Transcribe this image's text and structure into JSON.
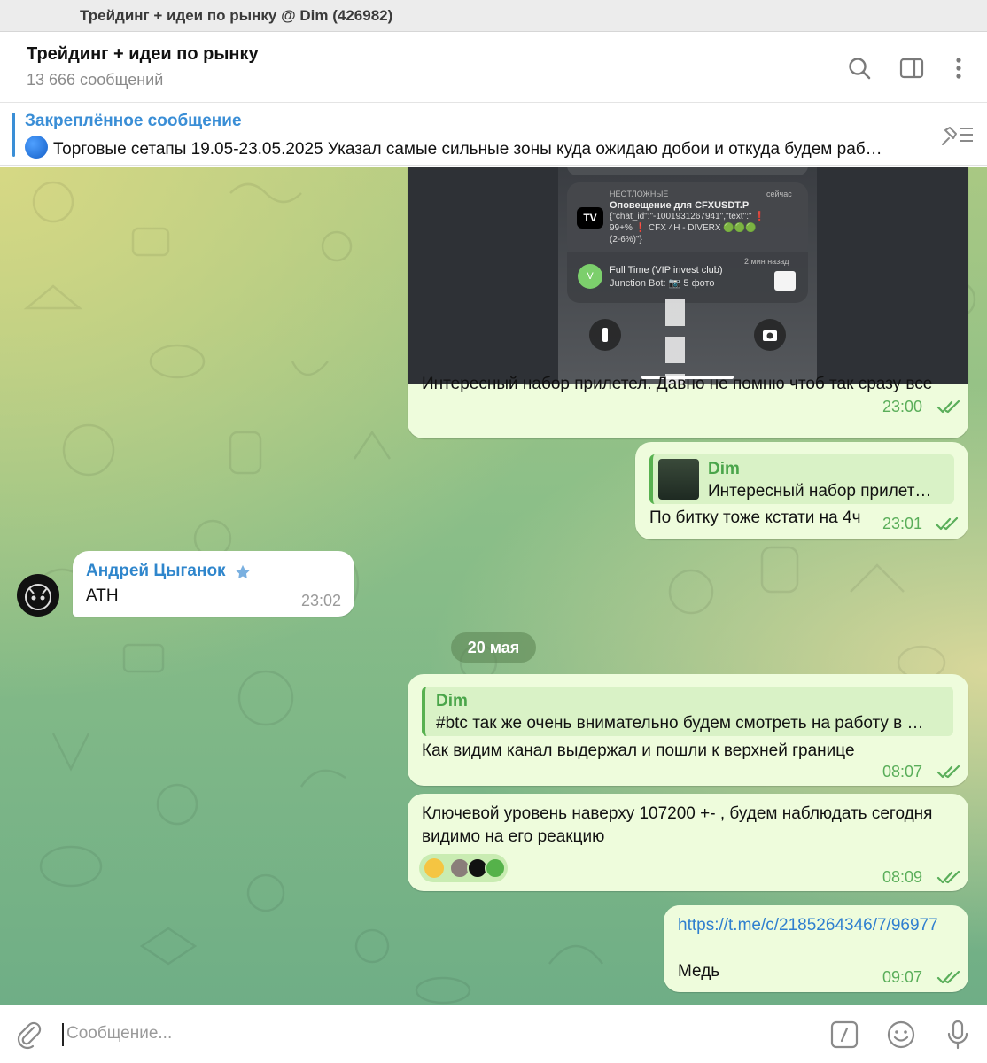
{
  "window": {
    "title": "Трейдинг + идеи по рынку @ Dim (426982)"
  },
  "header": {
    "chat_name": "Трейдинг + идеи по рынку",
    "message_count": "13 666 сообщений"
  },
  "pinned": {
    "title": "Закреплённое сообщение",
    "text": "Торговые сетапы 19.05-23.05.2025  Указал самые сильные зоны куда ожидаю добои и откуда будем раб…"
  },
  "photo": {
    "notif1_tag": "НЕОТЛОЖНЫЕ",
    "notif1_time": "сейчас",
    "notif1_title": "Оповещение для CFXUSDT.P",
    "notif1_line1": "{\"chat_id\":\"-1001931267941\",\"text\":\" ❗",
    "notif1_line2": "99+% ❗ CFX 4H - DIVERX 🟢🟢🟢",
    "notif1_line3": "(2-6%)\"}",
    "notif1_logo": "TV",
    "notif2_title": "Full Time (VIP invest club)",
    "notif2_text": "Junction Bot: 📷 5 фото",
    "notif2_time": "2 мин назад",
    "notif2_avatar": "V"
  },
  "messages": [
    {
      "text": "Интересный набор прилетел. Давно не помню чтоб так сразу все",
      "time": "23:00"
    },
    {
      "reply_name": "Dim",
      "reply_text": "Интересный набор прилет…",
      "text": "По битку тоже кстати на 4ч",
      "time": "23:01"
    },
    {
      "sender": "Андрей Цыганок",
      "text": "ATH",
      "time": "23:02"
    },
    {
      "reply_name": "Dim",
      "reply_text": "#btc так же очень внимательно будем смотреть на работу в …",
      "text": "Как видим канал выдержал и пошли к верхней границе",
      "time": "08:07"
    },
    {
      "text_line1": "Ключевой уровень наверху 107200 +- , будем наблюдать сегодня",
      "text_line2": "видимо на его реакцию",
      "time": "08:09"
    },
    {
      "link": "https://t.me/c/2185264346/7/96977",
      "text": "Медь",
      "time": "09:07"
    }
  ],
  "date_separator": "20 мая",
  "composer": {
    "placeholder": "Сообщение..."
  },
  "icons": {
    "search": "search-icon",
    "sidebar": "sidebar-toggle-icon",
    "more": "more-vertical-icon",
    "unpin": "pin-list-icon",
    "attach": "paperclip-icon",
    "commands": "slash-commands-icon",
    "emoji": "emoji-icon",
    "mic": "microphone-icon",
    "star": "star-icon",
    "read": "double-check-icon"
  },
  "colors": {
    "accent": "#3a8ed6",
    "outgoing_bubble": "#eefcdc",
    "outgoing_meta": "#5aae5a"
  }
}
